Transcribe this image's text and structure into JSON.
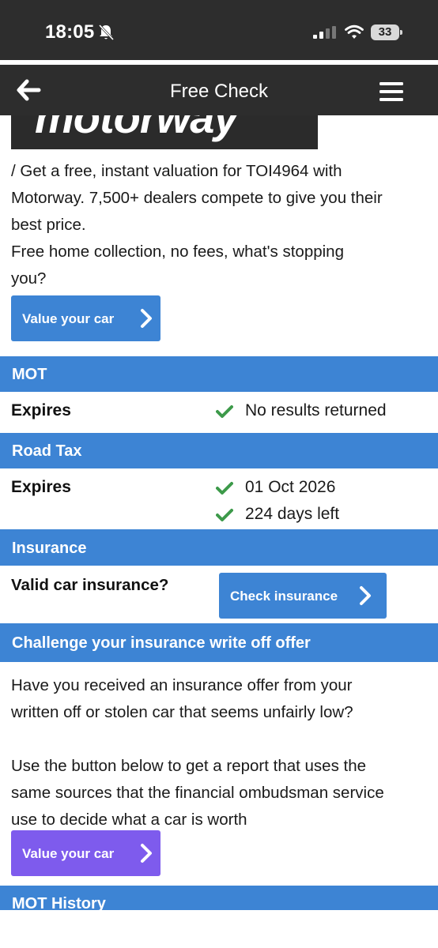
{
  "status_bar": {
    "time": "18:05",
    "battery_level": "33",
    "icons": [
      "bell-slash-icon",
      "cellular-signal-icon",
      "wifi-icon",
      "battery-icon"
    ]
  },
  "nav": {
    "title": "Free Check",
    "back_icon": "arrow-left-icon",
    "menu_icon": "hamburger-menu-icon"
  },
  "banner": {
    "logo_text": "motorway"
  },
  "motorway_promo": {
    "line1": "/ Get a free, instant valuation for TOI4964 with",
    "line2": "Motorway. 7,500+ dealers compete to give you their",
    "line3": "best price.",
    "line4": "Free home collection, no fees, what's stopping",
    "line5": "you?",
    "button_label": "Value your car"
  },
  "mot": {
    "heading": "MOT",
    "expires_label": "Expires",
    "expires_value": "No results returned"
  },
  "road_tax": {
    "heading": "Road Tax",
    "expires_label": "Expires",
    "expiry_date": "01 Oct 2026",
    "days_left": "224 days left"
  },
  "insurance": {
    "heading": "Insurance",
    "question": "Valid car insurance?",
    "button_label": "Check insurance"
  },
  "write_off": {
    "heading": "Challenge your insurance write off offer",
    "line1": "Have you received an insurance offer from your",
    "line2": "written off or stolen car that seems unfairly low?",
    "line3": "Use the button below to get a report that uses the",
    "line4": "same sources that the financial ombudsman service",
    "line5": "use to decide what a car is worth",
    "button_label": "Value your car"
  },
  "mot_history": {
    "heading": "MOT History"
  },
  "colors": {
    "section_blue": "#3d84d4",
    "button_purple": "#7e5bed",
    "check_green": "#3d9a4a",
    "bar_dark": "#2d2d2d"
  }
}
